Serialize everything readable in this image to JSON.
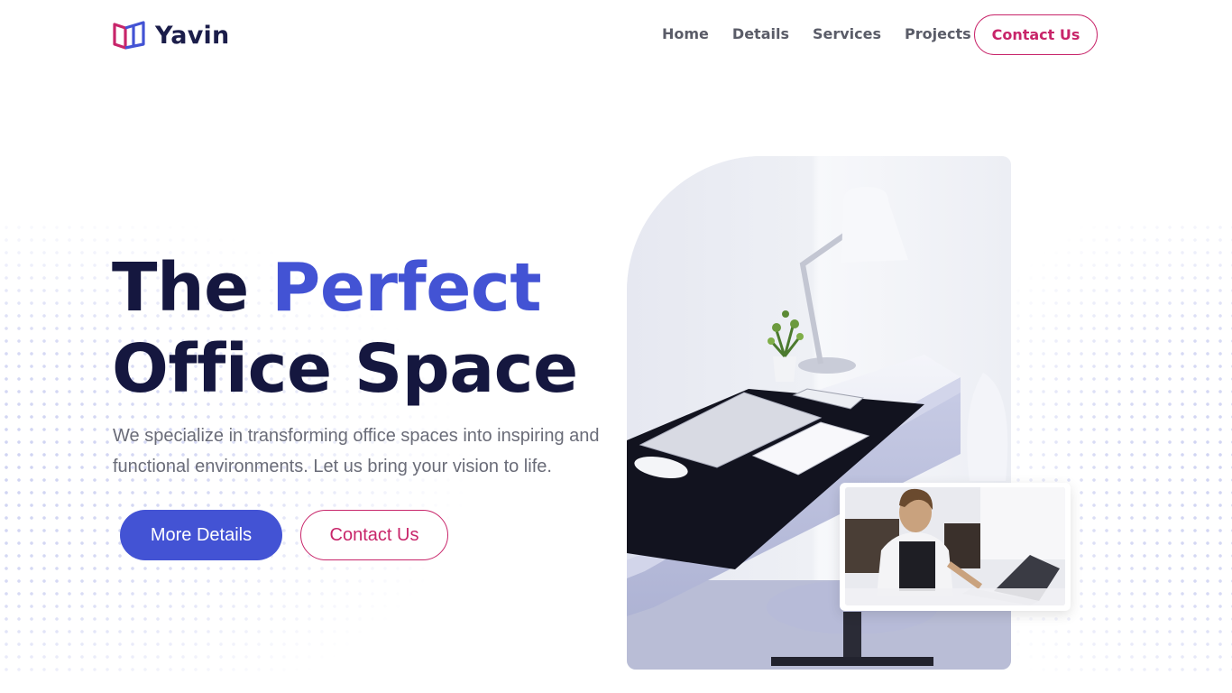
{
  "brand": {
    "name": "Yavin"
  },
  "nav": {
    "items": [
      {
        "label": "Home"
      },
      {
        "label": "Details"
      },
      {
        "label": "Services"
      },
      {
        "label": "Projects"
      }
    ],
    "contact_label": "Contact Us"
  },
  "hero": {
    "headline_part1": "The",
    "headline_accent": "Perfect",
    "headline_part2": "Office Space",
    "subtext": "We specialize in transforming office spaces into inspiring and functional environments. Let us bring your vision to life.",
    "primary_button": "More Details",
    "secondary_button": "Contact Us"
  },
  "colors": {
    "accent_blue": "#4353d4",
    "accent_pink": "#c8256a",
    "heading_navy": "#15173f"
  },
  "images": {
    "main": "office-desk-photo",
    "inset": "woman-working-photo"
  }
}
